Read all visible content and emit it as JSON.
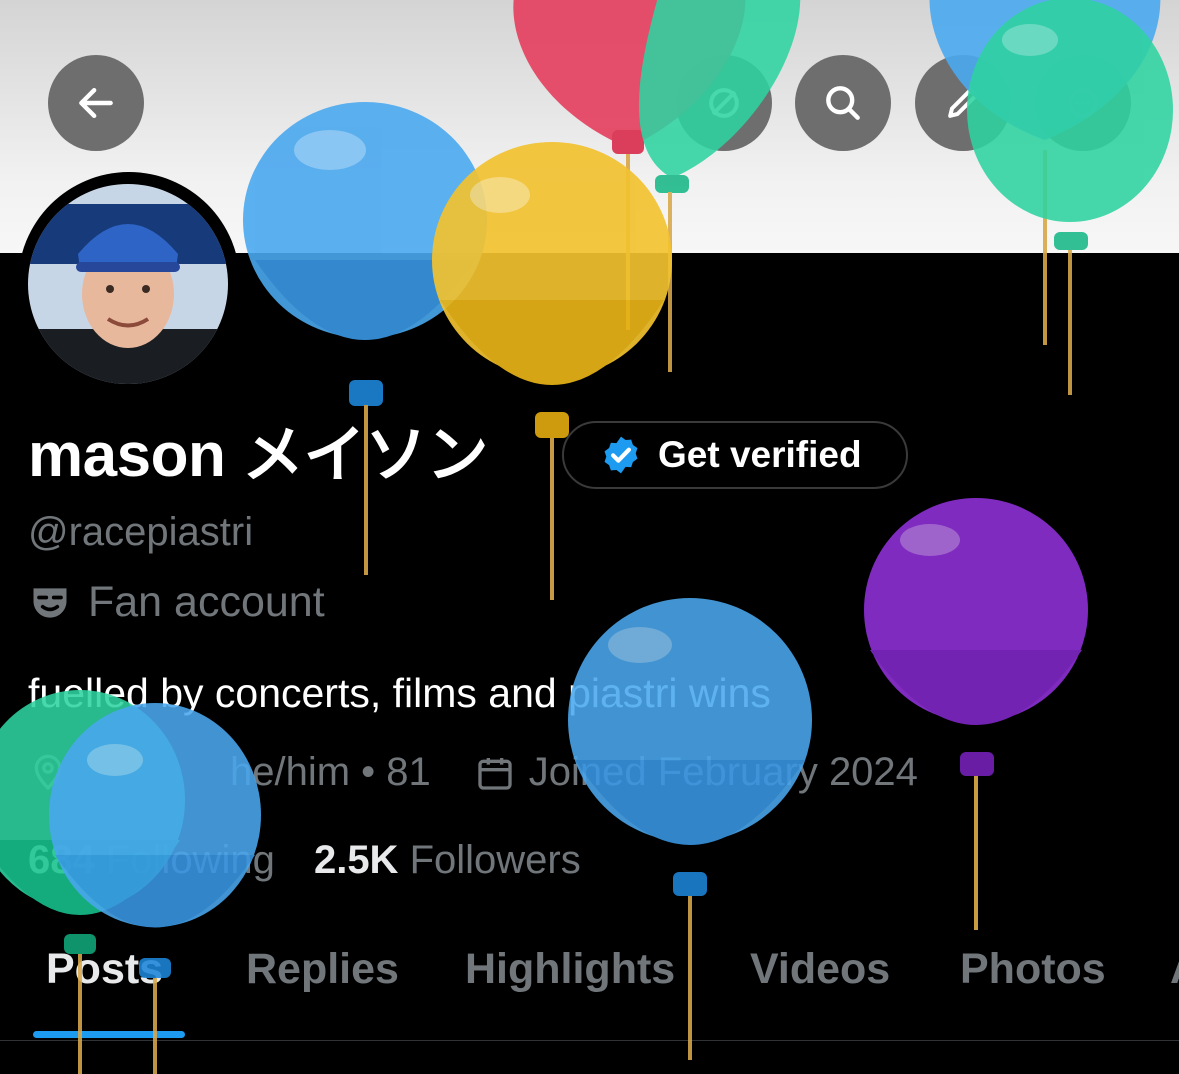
{
  "profile": {
    "display_name": "mason メイソン",
    "handle": "@racepiastri",
    "label": "Fan account",
    "bio": "fuelled by concerts, films and piastri wins",
    "location_pronouns_age": "he/him • 81",
    "joined": "Joined February 2024",
    "following_count": "684",
    "following_label": " Following",
    "followers_count": "2.5K",
    "followers_label": " Followers"
  },
  "verify_button": {
    "label": "Get verified"
  },
  "header_actions": [
    "arrow-left-icon",
    "grok-icon",
    "search-icon",
    "edit-icon",
    "more-icon"
  ],
  "tabs": [
    "Posts",
    "Replies",
    "Highlights",
    "Videos",
    "Photos",
    "A"
  ],
  "active_tab": "Posts",
  "colors": {
    "accent": "#1d9bf0",
    "muted_text": "#71767b",
    "background": "#000000",
    "banner": "#e6e6e6",
    "balloon_blue": "#4aa8ef",
    "balloon_yellow": "#f2c230",
    "balloon_red": "#e5415f",
    "balloon_green": "#2ed3a0",
    "balloon_purple": "#8a2fd0"
  }
}
